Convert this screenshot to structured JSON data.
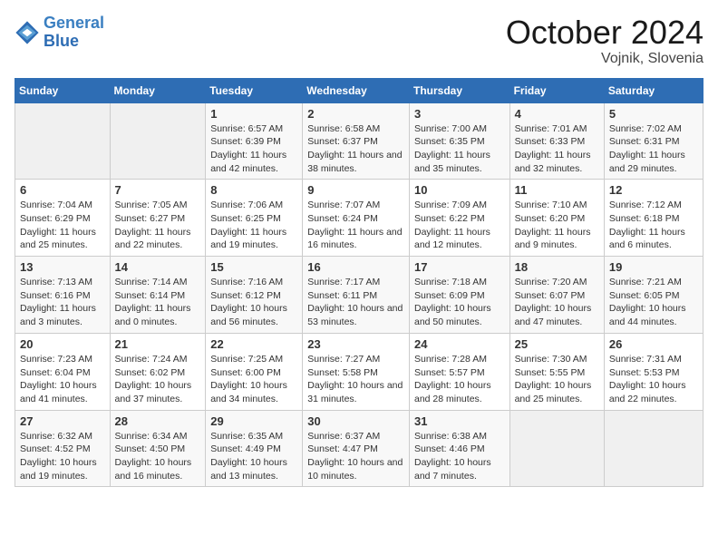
{
  "header": {
    "logo_line1": "General",
    "logo_line2": "Blue",
    "month_year": "October 2024",
    "location": "Vojnik, Slovenia"
  },
  "weekdays": [
    "Sunday",
    "Monday",
    "Tuesday",
    "Wednesday",
    "Thursday",
    "Friday",
    "Saturday"
  ],
  "weeks": [
    [
      {
        "day": "",
        "info": ""
      },
      {
        "day": "",
        "info": ""
      },
      {
        "day": "1",
        "info": "Sunrise: 6:57 AM\nSunset: 6:39 PM\nDaylight: 11 hours and 42 minutes."
      },
      {
        "day": "2",
        "info": "Sunrise: 6:58 AM\nSunset: 6:37 PM\nDaylight: 11 hours and 38 minutes."
      },
      {
        "day": "3",
        "info": "Sunrise: 7:00 AM\nSunset: 6:35 PM\nDaylight: 11 hours and 35 minutes."
      },
      {
        "day": "4",
        "info": "Sunrise: 7:01 AM\nSunset: 6:33 PM\nDaylight: 11 hours and 32 minutes."
      },
      {
        "day": "5",
        "info": "Sunrise: 7:02 AM\nSunset: 6:31 PM\nDaylight: 11 hours and 29 minutes."
      }
    ],
    [
      {
        "day": "6",
        "info": "Sunrise: 7:04 AM\nSunset: 6:29 PM\nDaylight: 11 hours and 25 minutes."
      },
      {
        "day": "7",
        "info": "Sunrise: 7:05 AM\nSunset: 6:27 PM\nDaylight: 11 hours and 22 minutes."
      },
      {
        "day": "8",
        "info": "Sunrise: 7:06 AM\nSunset: 6:25 PM\nDaylight: 11 hours and 19 minutes."
      },
      {
        "day": "9",
        "info": "Sunrise: 7:07 AM\nSunset: 6:24 PM\nDaylight: 11 hours and 16 minutes."
      },
      {
        "day": "10",
        "info": "Sunrise: 7:09 AM\nSunset: 6:22 PM\nDaylight: 11 hours and 12 minutes."
      },
      {
        "day": "11",
        "info": "Sunrise: 7:10 AM\nSunset: 6:20 PM\nDaylight: 11 hours and 9 minutes."
      },
      {
        "day": "12",
        "info": "Sunrise: 7:12 AM\nSunset: 6:18 PM\nDaylight: 11 hours and 6 minutes."
      }
    ],
    [
      {
        "day": "13",
        "info": "Sunrise: 7:13 AM\nSunset: 6:16 PM\nDaylight: 11 hours and 3 minutes."
      },
      {
        "day": "14",
        "info": "Sunrise: 7:14 AM\nSunset: 6:14 PM\nDaylight: 11 hours and 0 minutes."
      },
      {
        "day": "15",
        "info": "Sunrise: 7:16 AM\nSunset: 6:12 PM\nDaylight: 10 hours and 56 minutes."
      },
      {
        "day": "16",
        "info": "Sunrise: 7:17 AM\nSunset: 6:11 PM\nDaylight: 10 hours and 53 minutes."
      },
      {
        "day": "17",
        "info": "Sunrise: 7:18 AM\nSunset: 6:09 PM\nDaylight: 10 hours and 50 minutes."
      },
      {
        "day": "18",
        "info": "Sunrise: 7:20 AM\nSunset: 6:07 PM\nDaylight: 10 hours and 47 minutes."
      },
      {
        "day": "19",
        "info": "Sunrise: 7:21 AM\nSunset: 6:05 PM\nDaylight: 10 hours and 44 minutes."
      }
    ],
    [
      {
        "day": "20",
        "info": "Sunrise: 7:23 AM\nSunset: 6:04 PM\nDaylight: 10 hours and 41 minutes."
      },
      {
        "day": "21",
        "info": "Sunrise: 7:24 AM\nSunset: 6:02 PM\nDaylight: 10 hours and 37 minutes."
      },
      {
        "day": "22",
        "info": "Sunrise: 7:25 AM\nSunset: 6:00 PM\nDaylight: 10 hours and 34 minutes."
      },
      {
        "day": "23",
        "info": "Sunrise: 7:27 AM\nSunset: 5:58 PM\nDaylight: 10 hours and 31 minutes."
      },
      {
        "day": "24",
        "info": "Sunrise: 7:28 AM\nSunset: 5:57 PM\nDaylight: 10 hours and 28 minutes."
      },
      {
        "day": "25",
        "info": "Sunrise: 7:30 AM\nSunset: 5:55 PM\nDaylight: 10 hours and 25 minutes."
      },
      {
        "day": "26",
        "info": "Sunrise: 7:31 AM\nSunset: 5:53 PM\nDaylight: 10 hours and 22 minutes."
      }
    ],
    [
      {
        "day": "27",
        "info": "Sunrise: 6:32 AM\nSunset: 4:52 PM\nDaylight: 10 hours and 19 minutes."
      },
      {
        "day": "28",
        "info": "Sunrise: 6:34 AM\nSunset: 4:50 PM\nDaylight: 10 hours and 16 minutes."
      },
      {
        "day": "29",
        "info": "Sunrise: 6:35 AM\nSunset: 4:49 PM\nDaylight: 10 hours and 13 minutes."
      },
      {
        "day": "30",
        "info": "Sunrise: 6:37 AM\nSunset: 4:47 PM\nDaylight: 10 hours and 10 minutes."
      },
      {
        "day": "31",
        "info": "Sunrise: 6:38 AM\nSunset: 4:46 PM\nDaylight: 10 hours and 7 minutes."
      },
      {
        "day": "",
        "info": ""
      },
      {
        "day": "",
        "info": ""
      }
    ]
  ]
}
